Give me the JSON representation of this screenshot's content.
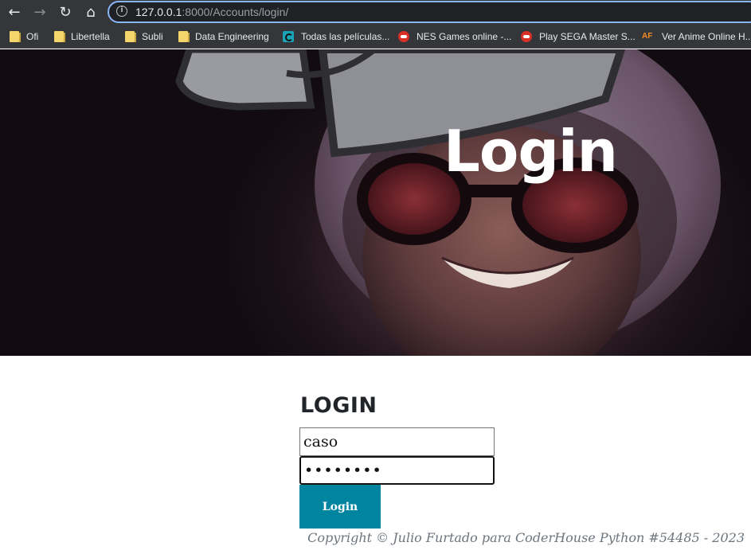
{
  "browser": {
    "url_host": "127.0.0.1",
    "url_rest": ":8000/Accounts/login/",
    "bookmarks": [
      {
        "label": "Ofi",
        "icon": "folder-icon"
      },
      {
        "label": "Libertella",
        "icon": "folder-icon"
      },
      {
        "label": "Subli",
        "icon": "folder-icon"
      },
      {
        "label": "Data Engineering",
        "icon": "folder-icon"
      },
      {
        "label": "Todas las películas...",
        "icon": "site-icon"
      },
      {
        "label": "NES Games online -...",
        "icon": "gamepad-icon"
      },
      {
        "label": "Play SEGA Master S...",
        "icon": "gamepad-icon"
      },
      {
        "label": "Ver Anime Online H...",
        "icon": "af-icon",
        "icon_text": "AF"
      }
    ]
  },
  "hero": {
    "title": "Login"
  },
  "form": {
    "heading": "LOGIN",
    "username_value": "caso",
    "password_value": "••••••••",
    "submit_label": "Login"
  },
  "footer": {
    "text": "Copyright © Julio Furtado para CoderHouse Python #54485 - 2023"
  },
  "colors": {
    "accent_button": "#0085a1",
    "omnibox_focus": "#8ab4f8",
    "chrome_bg": "#35363a"
  }
}
